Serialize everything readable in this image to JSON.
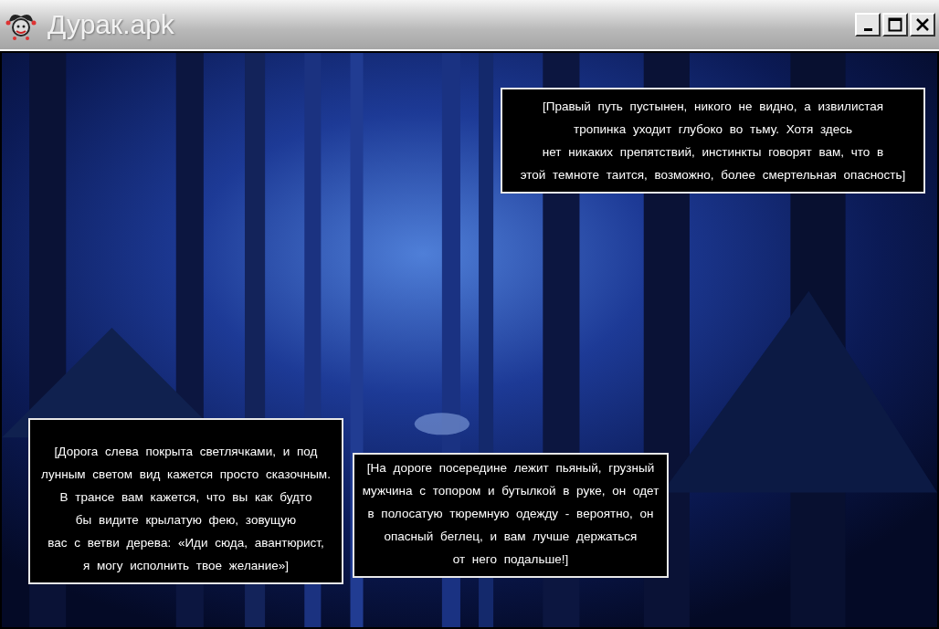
{
  "window": {
    "title": "Дурак.apk"
  },
  "dialogs": [
    {
      "lines": [
        "[Правый путь пустынен, никого не видно, а извилистая",
        "тропинка уходит глубоко во тьму. Хотя здесь",
        "нет никаких препятствий, инстинкты говорят вам, что в",
        "этой темноте таится, возможно, более смертельная опасность]"
      ]
    },
    {
      "lines": [
        "[Дорога слева покрыта светлячками, и под",
        "лунным светом вид кажется просто сказочным.",
        "В трансе вам кажется, что вы как будто",
        "бы видите крылатую фею, зовущую",
        "вас с ветви дерева: «Иди сюда, авантюрист,",
        "я могу исполнить твое желание»]"
      ]
    },
    {
      "lines": [
        "[На дороге посередине лежит пьяный, грузный",
        "мужчина с топором и бутылкой в руке, он одет",
        "в полосатую тюремную одежду - вероятно, он",
        "опасный беглец, и вам лучше держаться",
        "от него подальше!]"
      ]
    }
  ]
}
